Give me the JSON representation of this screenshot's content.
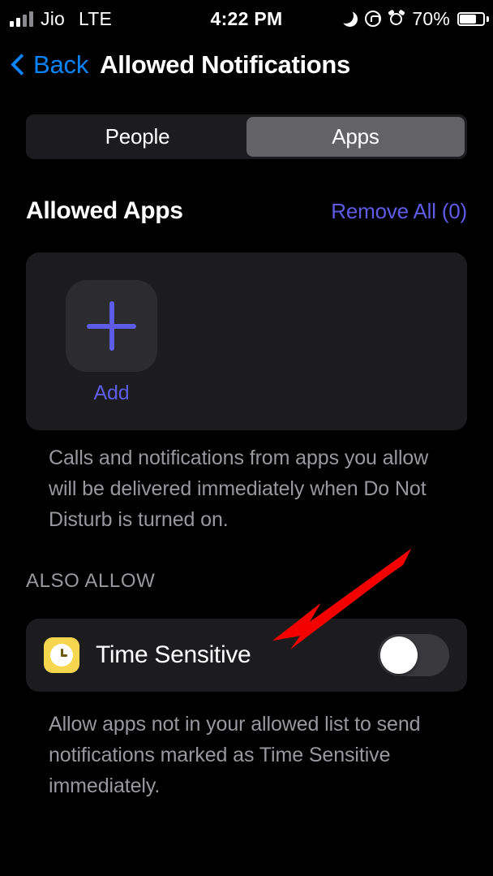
{
  "status_bar": {
    "carrier": "Jio",
    "network_type": "LTE",
    "time": "4:22 PM",
    "battery_percent": "70%",
    "icons": [
      "signal-bars-icon",
      "do-not-disturb-moon-icon",
      "rotation-lock-icon",
      "alarm-clock-icon",
      "battery-icon"
    ]
  },
  "nav": {
    "back_label": "Back",
    "title": "Allowed Notifications",
    "back_icon": "chevron-left-icon",
    "back_color": "#0a84ff"
  },
  "segmented_control": {
    "options": [
      {
        "label": "People",
        "selected": false
      },
      {
        "label": "Apps",
        "selected": true
      }
    ],
    "selected_bg": "#636366",
    "track_bg": "#1c1c1e"
  },
  "allowed_apps": {
    "title": "Allowed Apps",
    "action_label": "Remove All (0)",
    "action_color": "#5e5ce6",
    "add_label": "Add",
    "add_icon": "plus-icon",
    "description": "Calls and notifications from apps you allow will be delivered immediately when Do Not Disturb is turned on."
  },
  "also_allow": {
    "group_label": "ALSO ALLOW",
    "row": {
      "label": "Time Sensitive",
      "icon": "clock-icon",
      "icon_bg": "#f5d64e",
      "toggle_on": false
    },
    "description": "Allow apps not in your allowed list to send notifications marked as Time Sensitive immediately."
  },
  "annotation": {
    "type": "arrow",
    "color": "#f40000",
    "points_to": "time-sensitive-row"
  }
}
